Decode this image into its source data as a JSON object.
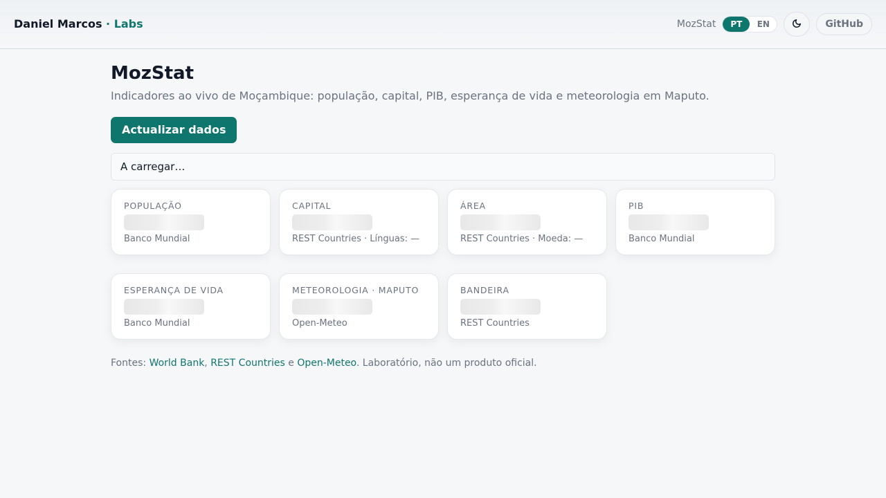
{
  "header": {
    "brand_name": "Daniel Marcos",
    "brand_separator": " · ",
    "brand_accent": "Labs",
    "app_label": "MozStat",
    "languages": [
      {
        "code": "PT",
        "active": true
      },
      {
        "code": "EN",
        "active": false
      }
    ],
    "theme_icon": "moon-icon",
    "github_label": "GitHub"
  },
  "main": {
    "title": "MozStat",
    "subtitle": "Indicadores ao vivo de Moçambique: população, capital, PIB, esperança de vida e meteorologia em Maputo.",
    "refresh_label": "Actualizar dados",
    "status": "A carregar…"
  },
  "cards": [
    {
      "label": "POPULAÇÃO",
      "source": "Banco Mundial"
    },
    {
      "label": "CAPITAL",
      "source": "REST Countries · Línguas: —"
    },
    {
      "label": "ÁREA",
      "source": "REST Countries · Moeda: —"
    },
    {
      "label": "PIB",
      "source": "Banco Mundial"
    },
    {
      "label": "ESPERANÇA DE VIDA",
      "source": "Banco Mundial"
    },
    {
      "label": "METEOROLOGIA · MAPUTO",
      "source": "Open-Meteo"
    },
    {
      "label": "BANDEIRA",
      "source": "REST Countries"
    }
  ],
  "footer": {
    "prefix": "Fontes: ",
    "link1": "World Bank",
    "sep1": ", ",
    "link2": "REST Countries",
    "sep2": " e ",
    "link3": "Open-Meteo",
    "suffix": ". Laboratório, não um produto oficial."
  },
  "colors": {
    "accent": "#0f766e",
    "background": "#f6f7f9"
  }
}
